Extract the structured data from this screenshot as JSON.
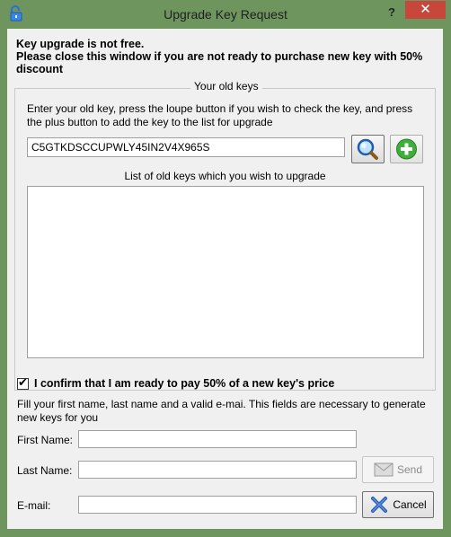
{
  "window": {
    "title": "Upgrade Key Request",
    "help": "?",
    "close": "✕"
  },
  "warning": {
    "line1": "Key upgrade is not free.",
    "line2": "Please close this window if you are not ready to purchase new key with 50% discount"
  },
  "old_keys": {
    "group_title": "Your old keys",
    "instructions": "Enter your old key, press the loupe button if you wish to check the key, and press the plus button to add the key to the list for upgrade",
    "key_value": "C5GTKDSCCUPWLY45IN2V4X965S",
    "list_title": "List of old keys which you wish to upgrade",
    "items": []
  },
  "confirm": {
    "checked": true,
    "label": "I confirm that I am ready to pay 50%  of a new key's price"
  },
  "form": {
    "instructions": "Fill your first name, last name and a valid e-mai. This fields are necessary to generate new keys for you",
    "first_name_label": "First Name:",
    "first_name_value": "",
    "last_name_label": "Last Name:",
    "last_name_value": "",
    "email_label": "E-mail:",
    "email_value": ""
  },
  "buttons": {
    "send": "Send",
    "cancel": "Cancel"
  },
  "icons": {
    "app": "padlock-icon",
    "check": "loupe-icon",
    "add": "plus-icon",
    "send": "envelope-icon",
    "cancel": "x-icon"
  },
  "colors": {
    "frame": "#6f955f",
    "close": "#c7473c"
  }
}
